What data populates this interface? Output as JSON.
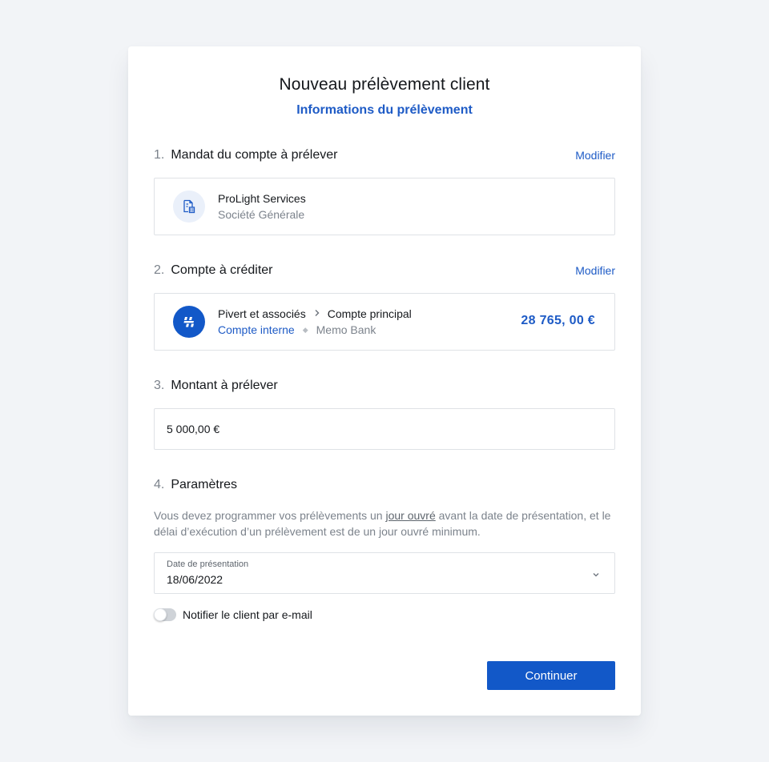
{
  "dialog": {
    "title": "Nouveau prélèvement client",
    "subtitle": "Informations du prélèvement"
  },
  "sections": {
    "mandate": {
      "number": "1.",
      "label": "Mandat du compte à prélever",
      "action": "Modifier",
      "name": "ProLight Services",
      "bank": "Société Générale",
      "icon": "document-building-icon"
    },
    "credit_account": {
      "number": "2.",
      "label": "Compte à créditer",
      "action": "Modifier",
      "owner": "Pivert et associés",
      "account": "Compte principal",
      "type": "Compte interne",
      "bank": "Memo Bank",
      "balance": "28 765, 00 €",
      "icon": "memo-bank-logo-icon"
    },
    "amount": {
      "number": "3.",
      "label": "Montant à prélever",
      "value": "5 000,00 €"
    },
    "params": {
      "number": "4.",
      "label": "Paramètres",
      "text_before": "Vous devez programmer vos prélèvements un ",
      "text_link": "jour ouvré",
      "text_after": " avant la date de présentation, et le délai d’exécution d’un prélèvement est de un jour ouvré minimum.",
      "date_label": "Date de présentation",
      "date_value": "18/06/2022",
      "notify_label": "Notifier le client par e-mail",
      "notify_enabled": false
    }
  },
  "footer": {
    "continue_label": "Continuer"
  },
  "colors": {
    "accent": "#1e5bc6",
    "button": "#1258c8",
    "background": "#f2f4f7"
  }
}
